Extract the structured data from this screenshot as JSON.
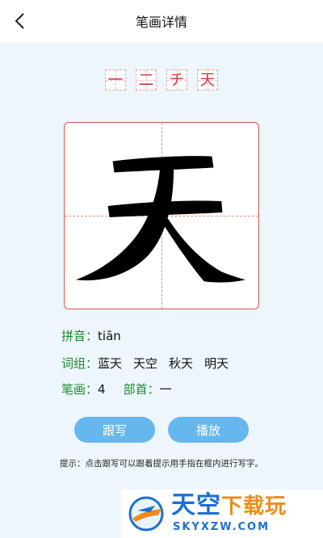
{
  "header": {
    "title": "笔画详情",
    "back_icon": "chevron-left-icon"
  },
  "stroke_order": [
    "一",
    "二",
    "チ",
    "天"
  ],
  "character": "天",
  "info": {
    "pinyin_label": "拼音：",
    "pinyin_value": "tiān",
    "words_label": "词组：",
    "words": [
      "蓝天",
      "天空",
      "秋天",
      "明天"
    ],
    "strokes_label": "笔画：",
    "strokes_value": "4",
    "radical_label": "部首：",
    "radical_value": "一"
  },
  "buttons": {
    "trace": "跟写",
    "play": "播放"
  },
  "tip": "提示：点击跟写可以跟着提示用手指在框内进行写字。",
  "watermark": {
    "title_blue": "天空",
    "title_orange": "下载玩",
    "url": "SKYXZW.COM"
  },
  "colors": {
    "accent_button": "#66b7ee",
    "label_green": "#1a8a2a",
    "grid_red": "#d9534f",
    "background": "#eef6fd"
  }
}
